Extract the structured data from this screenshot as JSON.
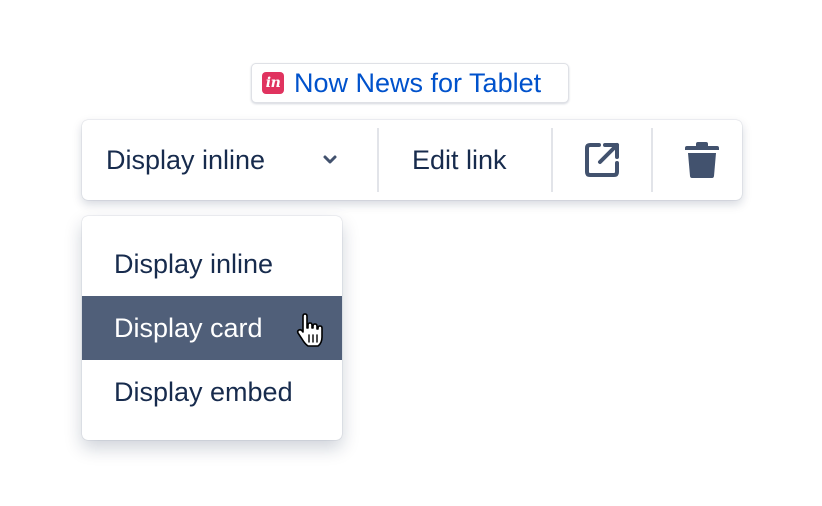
{
  "smart_link": {
    "icon": "invision-icon",
    "icon_glyph": "in",
    "icon_color": "#e0335f",
    "title": "Now News for Tablet",
    "text_color": "#0052cc"
  },
  "toolbar": {
    "display_label": "Display inline",
    "edit_label": "Edit link",
    "open_icon": "open-in-new-window-icon",
    "delete_icon": "trash-icon",
    "icon_color": "#42526e"
  },
  "menu": {
    "items": [
      {
        "label": "Display inline",
        "active": false
      },
      {
        "label": "Display card",
        "active": true
      },
      {
        "label": "Display embed",
        "active": false
      }
    ],
    "active_bg": "#505f79"
  },
  "cursor": "hand-pointer-icon"
}
